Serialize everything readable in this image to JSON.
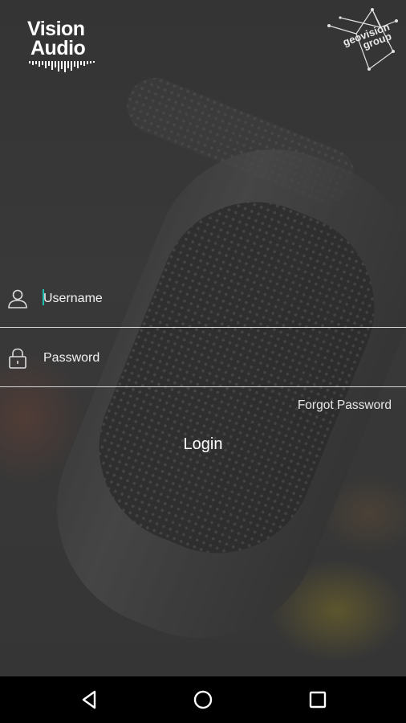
{
  "brand": {
    "left_logo_line1": "Vision",
    "left_logo_line2": "Audio",
    "right_logo_line1": "geovision",
    "right_logo_line2": "group"
  },
  "login_form": {
    "username_placeholder": "Username",
    "password_placeholder": "Password",
    "forgot_password_label": "Forgot Password",
    "login_label": "Login"
  },
  "icons": {
    "username": "user-outline-icon",
    "password": "lock-outline-icon",
    "nav_back": "triangle-back-icon",
    "nav_home": "circle-home-icon",
    "nav_recents": "square-recents-icon"
  },
  "colors": {
    "cursor": "#1fbfb0",
    "text": "#ffffff",
    "underline": "#d8d8d8",
    "navbar": "#000000"
  }
}
